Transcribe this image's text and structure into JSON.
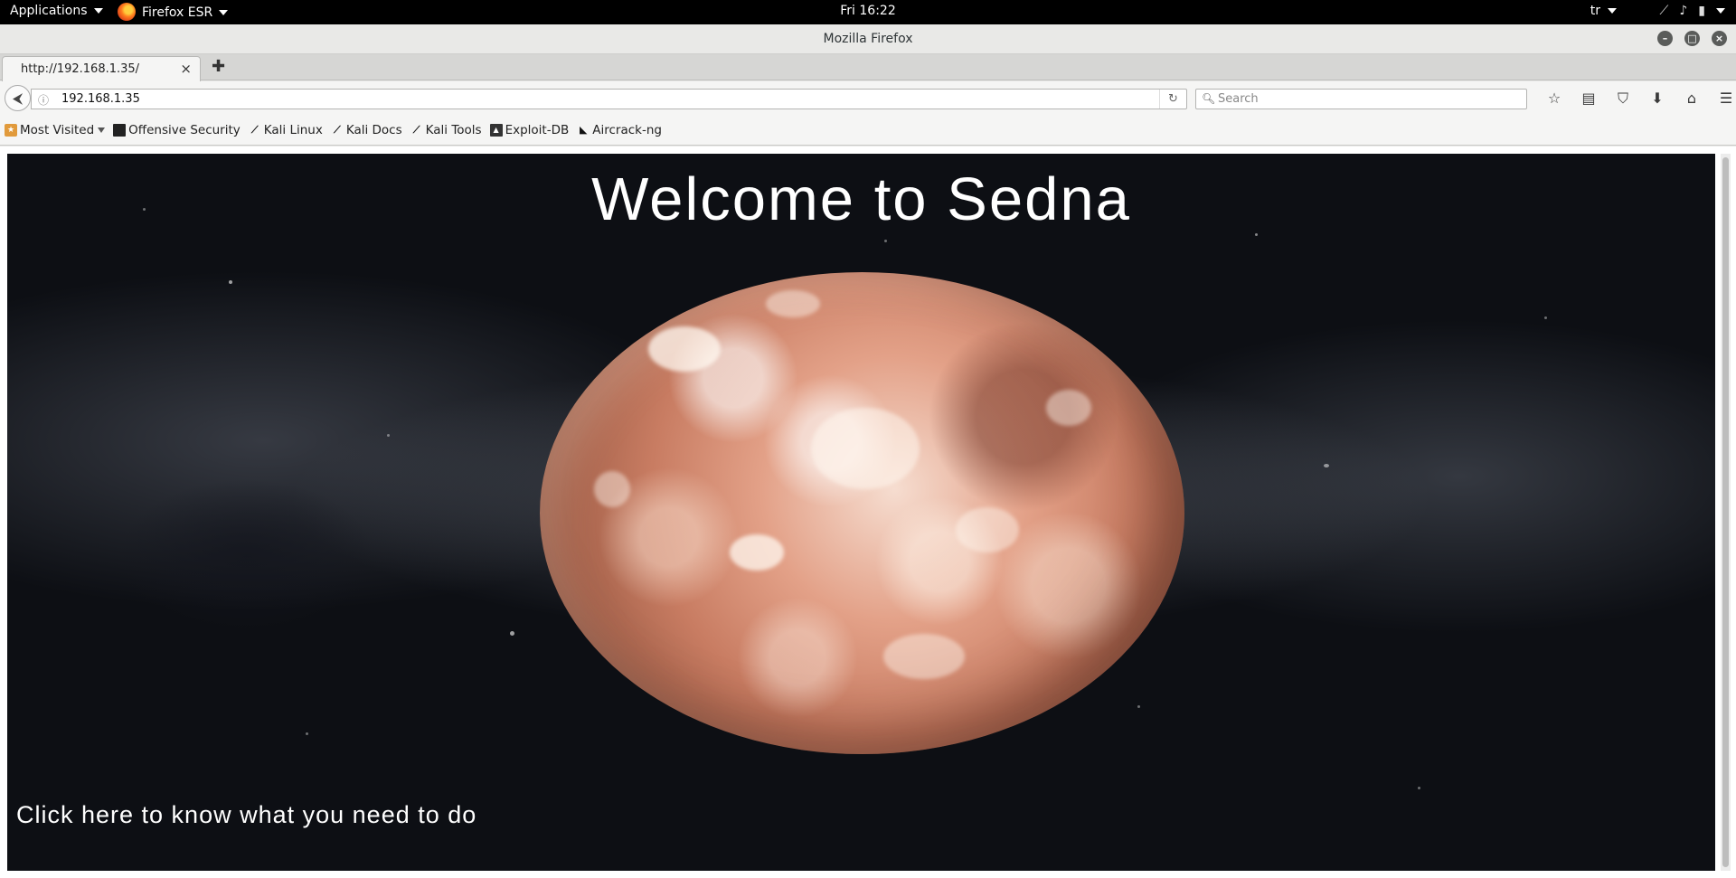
{
  "system_bar": {
    "applications_label": "Applications",
    "app_label": "Firefox ESR",
    "clock": "Fri 16:22",
    "keyboard_layout": "tr"
  },
  "window": {
    "title": "Mozilla Firefox"
  },
  "tabs": [
    {
      "title": "http://192.168.1.35/"
    }
  ],
  "navbar": {
    "url": "192.168.1.35",
    "search_placeholder": "Search"
  },
  "bookmarks": [
    {
      "label": "Most Visited",
      "icon": "folder-icon"
    },
    {
      "label": "Offensive Security",
      "icon": "offsec-icon"
    },
    {
      "label": "Kali Linux",
      "icon": "kali-dragon-icon"
    },
    {
      "label": "Kali Docs",
      "icon": "kali-dragon-icon"
    },
    {
      "label": "Kali Tools",
      "icon": "kali-dragon-icon"
    },
    {
      "label": "Exploit-DB",
      "icon": "exploitdb-icon"
    },
    {
      "label": "Aircrack-ng",
      "icon": "aircrack-icon"
    }
  ],
  "page": {
    "heading": "Welcome to Sedna",
    "link_text": "Click here to know what you need to do"
  },
  "colors": {
    "system_bar_bg": "#000000",
    "page_bg": "#0d0f14",
    "planet_tone": "#c87c62"
  }
}
